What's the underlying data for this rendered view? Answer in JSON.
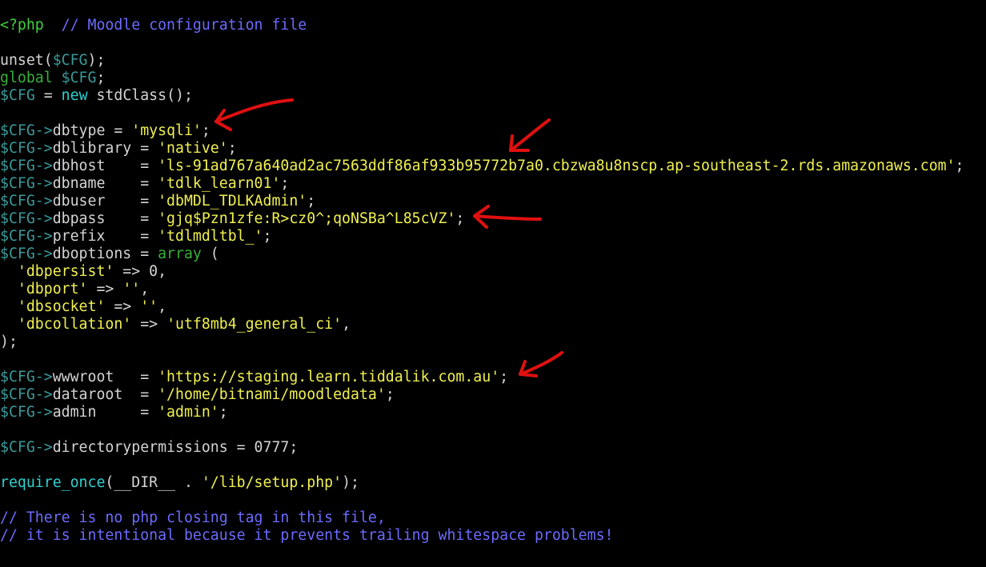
{
  "editor": {
    "lines": [
      [
        {
          "t": "<?php",
          "k": "tag"
        },
        {
          "t": "  ",
          "k": "text"
        },
        {
          "t": "// Moodle configuration file",
          "k": "comment"
        }
      ],
      [],
      [
        {
          "t": "unset(",
          "k": "text"
        },
        {
          "t": "$CFG",
          "k": "var"
        },
        {
          "t": ");",
          "k": "text"
        }
      ],
      [
        {
          "t": "global",
          "k": "kw"
        },
        {
          "t": " ",
          "k": "text"
        },
        {
          "t": "$CFG",
          "k": "var"
        },
        {
          "t": ";",
          "k": "text"
        }
      ],
      [
        {
          "t": "$CFG",
          "k": "var"
        },
        {
          "t": " = ",
          "k": "text"
        },
        {
          "t": "new",
          "k": "new"
        },
        {
          "t": " stdClass();",
          "k": "text"
        }
      ],
      [],
      [
        {
          "t": "$CFG->",
          "k": "var"
        },
        {
          "t": "dbtype = ",
          "k": "text"
        },
        {
          "t": "'mysqli'",
          "k": "str"
        },
        {
          "t": ";",
          "k": "text"
        }
      ],
      [
        {
          "t": "$CFG->",
          "k": "var"
        },
        {
          "t": "dblibrary = ",
          "k": "text"
        },
        {
          "t": "'native'",
          "k": "str"
        },
        {
          "t": ";",
          "k": "text"
        }
      ],
      [
        {
          "t": "$CFG->",
          "k": "var"
        },
        {
          "t": "dbhost    = ",
          "k": "text"
        },
        {
          "t": "'ls-91ad767a640ad2ac7563ddf86af933b95772b7a0.cbzwa8u8nscp.ap-southeast-2.rds.amazonaws.com'",
          "k": "str"
        },
        {
          "t": ";",
          "k": "text"
        }
      ],
      [
        {
          "t": "$CFG->",
          "k": "var"
        },
        {
          "t": "dbname    = ",
          "k": "text"
        },
        {
          "t": "'tdlk_learn01'",
          "k": "str"
        },
        {
          "t": ";",
          "k": "text"
        }
      ],
      [
        {
          "t": "$CFG->",
          "k": "var"
        },
        {
          "t": "dbuser    = ",
          "k": "text"
        },
        {
          "t": "'dbMDL_TDLKAdmin'",
          "k": "str"
        },
        {
          "t": ";",
          "k": "text"
        }
      ],
      [
        {
          "t": "$CFG->",
          "k": "var"
        },
        {
          "t": "dbpass    = ",
          "k": "text"
        },
        {
          "t": "'gjq$Pzn1zfe:R>cz0^;qoNSBa^L85cVZ'",
          "k": "str"
        },
        {
          "t": ";",
          "k": "text"
        }
      ],
      [
        {
          "t": "$CFG->",
          "k": "var"
        },
        {
          "t": "prefix    = ",
          "k": "text"
        },
        {
          "t": "'tdlmdltbl_'",
          "k": "str"
        },
        {
          "t": ";",
          "k": "text"
        }
      ],
      [
        {
          "t": "$CFG->",
          "k": "var"
        },
        {
          "t": "dboptions = ",
          "k": "text"
        },
        {
          "t": "array",
          "k": "kw"
        },
        {
          "t": " (",
          "k": "text"
        }
      ],
      [
        {
          "t": "  ",
          "k": "text"
        },
        {
          "t": "'dbpersist'",
          "k": "str"
        },
        {
          "t": " => 0,",
          "k": "text"
        }
      ],
      [
        {
          "t": "  ",
          "k": "text"
        },
        {
          "t": "'dbport'",
          "k": "str"
        },
        {
          "t": " => ",
          "k": "text"
        },
        {
          "t": "''",
          "k": "str"
        },
        {
          "t": ",",
          "k": "text"
        }
      ],
      [
        {
          "t": "  ",
          "k": "text"
        },
        {
          "t": "'dbsocket'",
          "k": "str"
        },
        {
          "t": " => ",
          "k": "text"
        },
        {
          "t": "''",
          "k": "str"
        },
        {
          "t": ",",
          "k": "text"
        }
      ],
      [
        {
          "t": "  ",
          "k": "text"
        },
        {
          "t": "'dbcollation'",
          "k": "str"
        },
        {
          "t": " => ",
          "k": "text"
        },
        {
          "t": "'utf8mb4_general_ci'",
          "k": "str"
        },
        {
          "t": ",",
          "k": "text"
        }
      ],
      [
        {
          "t": ");",
          "k": "text"
        }
      ],
      [],
      [
        {
          "t": "$CFG->",
          "k": "var"
        },
        {
          "t": "wwwroot   = ",
          "k": "text"
        },
        {
          "t": "'https://staging.learn.tiddalik.com.au'",
          "k": "str"
        },
        {
          "t": ";",
          "k": "text"
        }
      ],
      [
        {
          "t": "$CFG->",
          "k": "var"
        },
        {
          "t": "dataroot  = ",
          "k": "text"
        },
        {
          "t": "'/home/bitnami/moodledata'",
          "k": "str"
        },
        {
          "t": ";",
          "k": "text"
        }
      ],
      [
        {
          "t": "$CFG->",
          "k": "var"
        },
        {
          "t": "admin     = ",
          "k": "text"
        },
        {
          "t": "'admin'",
          "k": "str"
        },
        {
          "t": ";",
          "k": "text"
        }
      ],
      [],
      [
        {
          "t": "$CFG->",
          "k": "var"
        },
        {
          "t": "directorypermissions = 0777;",
          "k": "text"
        }
      ],
      [],
      [
        {
          "t": "require_once",
          "k": "new"
        },
        {
          "t": "(__DIR__ . ",
          "k": "text"
        },
        {
          "t": "'/lib/setup.php'",
          "k": "str"
        },
        {
          "t": ");",
          "k": "text"
        }
      ],
      [],
      [
        {
          "t": "// There is no php closing tag in this file,",
          "k": "comment"
        }
      ],
      [
        {
          "t": "// it is intentional because it prevents trailing whitespace problems!",
          "k": "comment"
        }
      ]
    ]
  },
  "colors": {
    "background": "#000000",
    "text": "#d4d4d4",
    "tag": "#40d040",
    "comment": "#6b6bff",
    "variable": "#3a9a9a",
    "string": "#f0f050",
    "keyword": "#3ab03a",
    "builtin": "#30d0d0",
    "annotation_arrow": "#e01010"
  },
  "annotations": {
    "arrows": [
      {
        "name": "arrow-dbtype-icon",
        "points_to": "dbtype"
      },
      {
        "name": "arrow-dbhost-icon",
        "points_to": "dbhost"
      },
      {
        "name": "arrow-dbpass-icon",
        "points_to": "dbpass"
      },
      {
        "name": "arrow-wwwroot-icon",
        "points_to": "wwwroot"
      }
    ]
  }
}
